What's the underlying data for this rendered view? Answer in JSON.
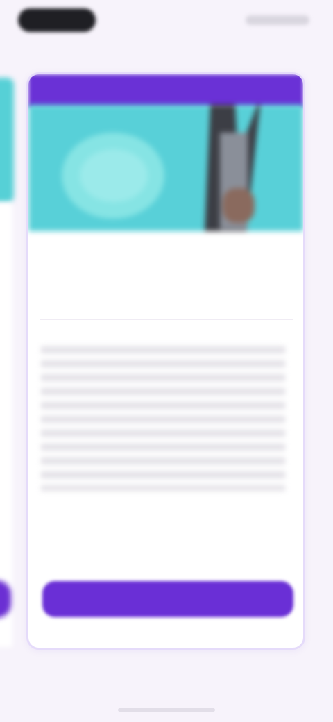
{
  "status_bar": {},
  "header": {
    "title": ""
  },
  "card": {
    "ribbon_label": "",
    "hero": {
      "accent_color": "#58d0d8"
    },
    "product_name": "",
    "price": "",
    "price_note": "",
    "subtitle": "",
    "description": "",
    "terms": "",
    "terms_link": "",
    "cta_label": "",
    "footer_note": ""
  },
  "pager": {
    "text": ""
  },
  "colors": {
    "background": "#f7f3fb",
    "brand_purple": "#6a31d6",
    "hero_teal": "#58d0d8",
    "card_border": "#e5dbfa"
  }
}
